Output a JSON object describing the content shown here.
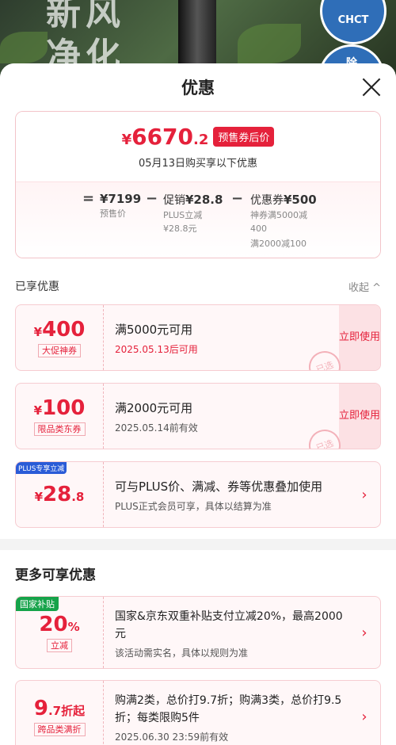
{
  "background": {
    "text_lines": [
      "新风",
      "净化"
    ],
    "seal_top": "CHCT",
    "seal_bottom": "除"
  },
  "sheet": {
    "title": "优惠"
  },
  "summary": {
    "currency": "¥",
    "final_int": "6670",
    "final_dec": ".2",
    "tag": "预售券后价",
    "note": "05月13日购买享以下优惠",
    "eq": "=",
    "minus": "−",
    "presale": {
      "value": "¥7199",
      "label": "预售价"
    },
    "promo": {
      "label": "促销",
      "value": "¥28.8",
      "sub1": "PLUS立减",
      "sub2": "¥28.8元"
    },
    "coupon": {
      "label": "优惠券",
      "value": "¥500",
      "sub1": "神券满5000减",
      "sub2": "400",
      "sub3": "满2000减100"
    }
  },
  "enjoyed": {
    "title": "已享优惠",
    "collapse": "收起 ^"
  },
  "coupons": [
    {
      "cur": "¥",
      "amount": "400",
      "label": "大促神券",
      "title": "满5000元可用",
      "date": "2025.05.13后可用",
      "use": "立即使用",
      "stamp": "已选"
    },
    {
      "cur": "¥",
      "amount": "100",
      "label": "限品类东券",
      "title": "满2000元可用",
      "date": "2025.05.14前有效",
      "use": "立即使用",
      "stamp": "已选"
    },
    {
      "tag": "PLUS专享立减",
      "cur": "¥",
      "amount": "28",
      "dec": ".8",
      "title": "可与PLUS价、满减、券等优惠叠加使用",
      "date": "PLUS正式会员可享，具体以结算为准"
    }
  ],
  "more": {
    "title": "更多可享优惠",
    "items": [
      {
        "tag": "国家补贴",
        "amount": "20",
        "unit": "%",
        "label": "立减",
        "desc": "国家&京东双重补贴支付立减20%，最高2000元",
        "small": "该活动需实名，具体以规则为准"
      },
      {
        "amount": "9",
        "dec": ".7",
        "unit": "折起",
        "label": "跨品类满折",
        "desc": "购满2类，总价打9.7折；购满3类，总价打9.5折；每类限购5件",
        "small": "2025.06.30 23:59前有效"
      }
    ]
  },
  "colors": {
    "accent": "#e5213b",
    "plus": "#2a5bd7",
    "gov": "#16a34a"
  }
}
